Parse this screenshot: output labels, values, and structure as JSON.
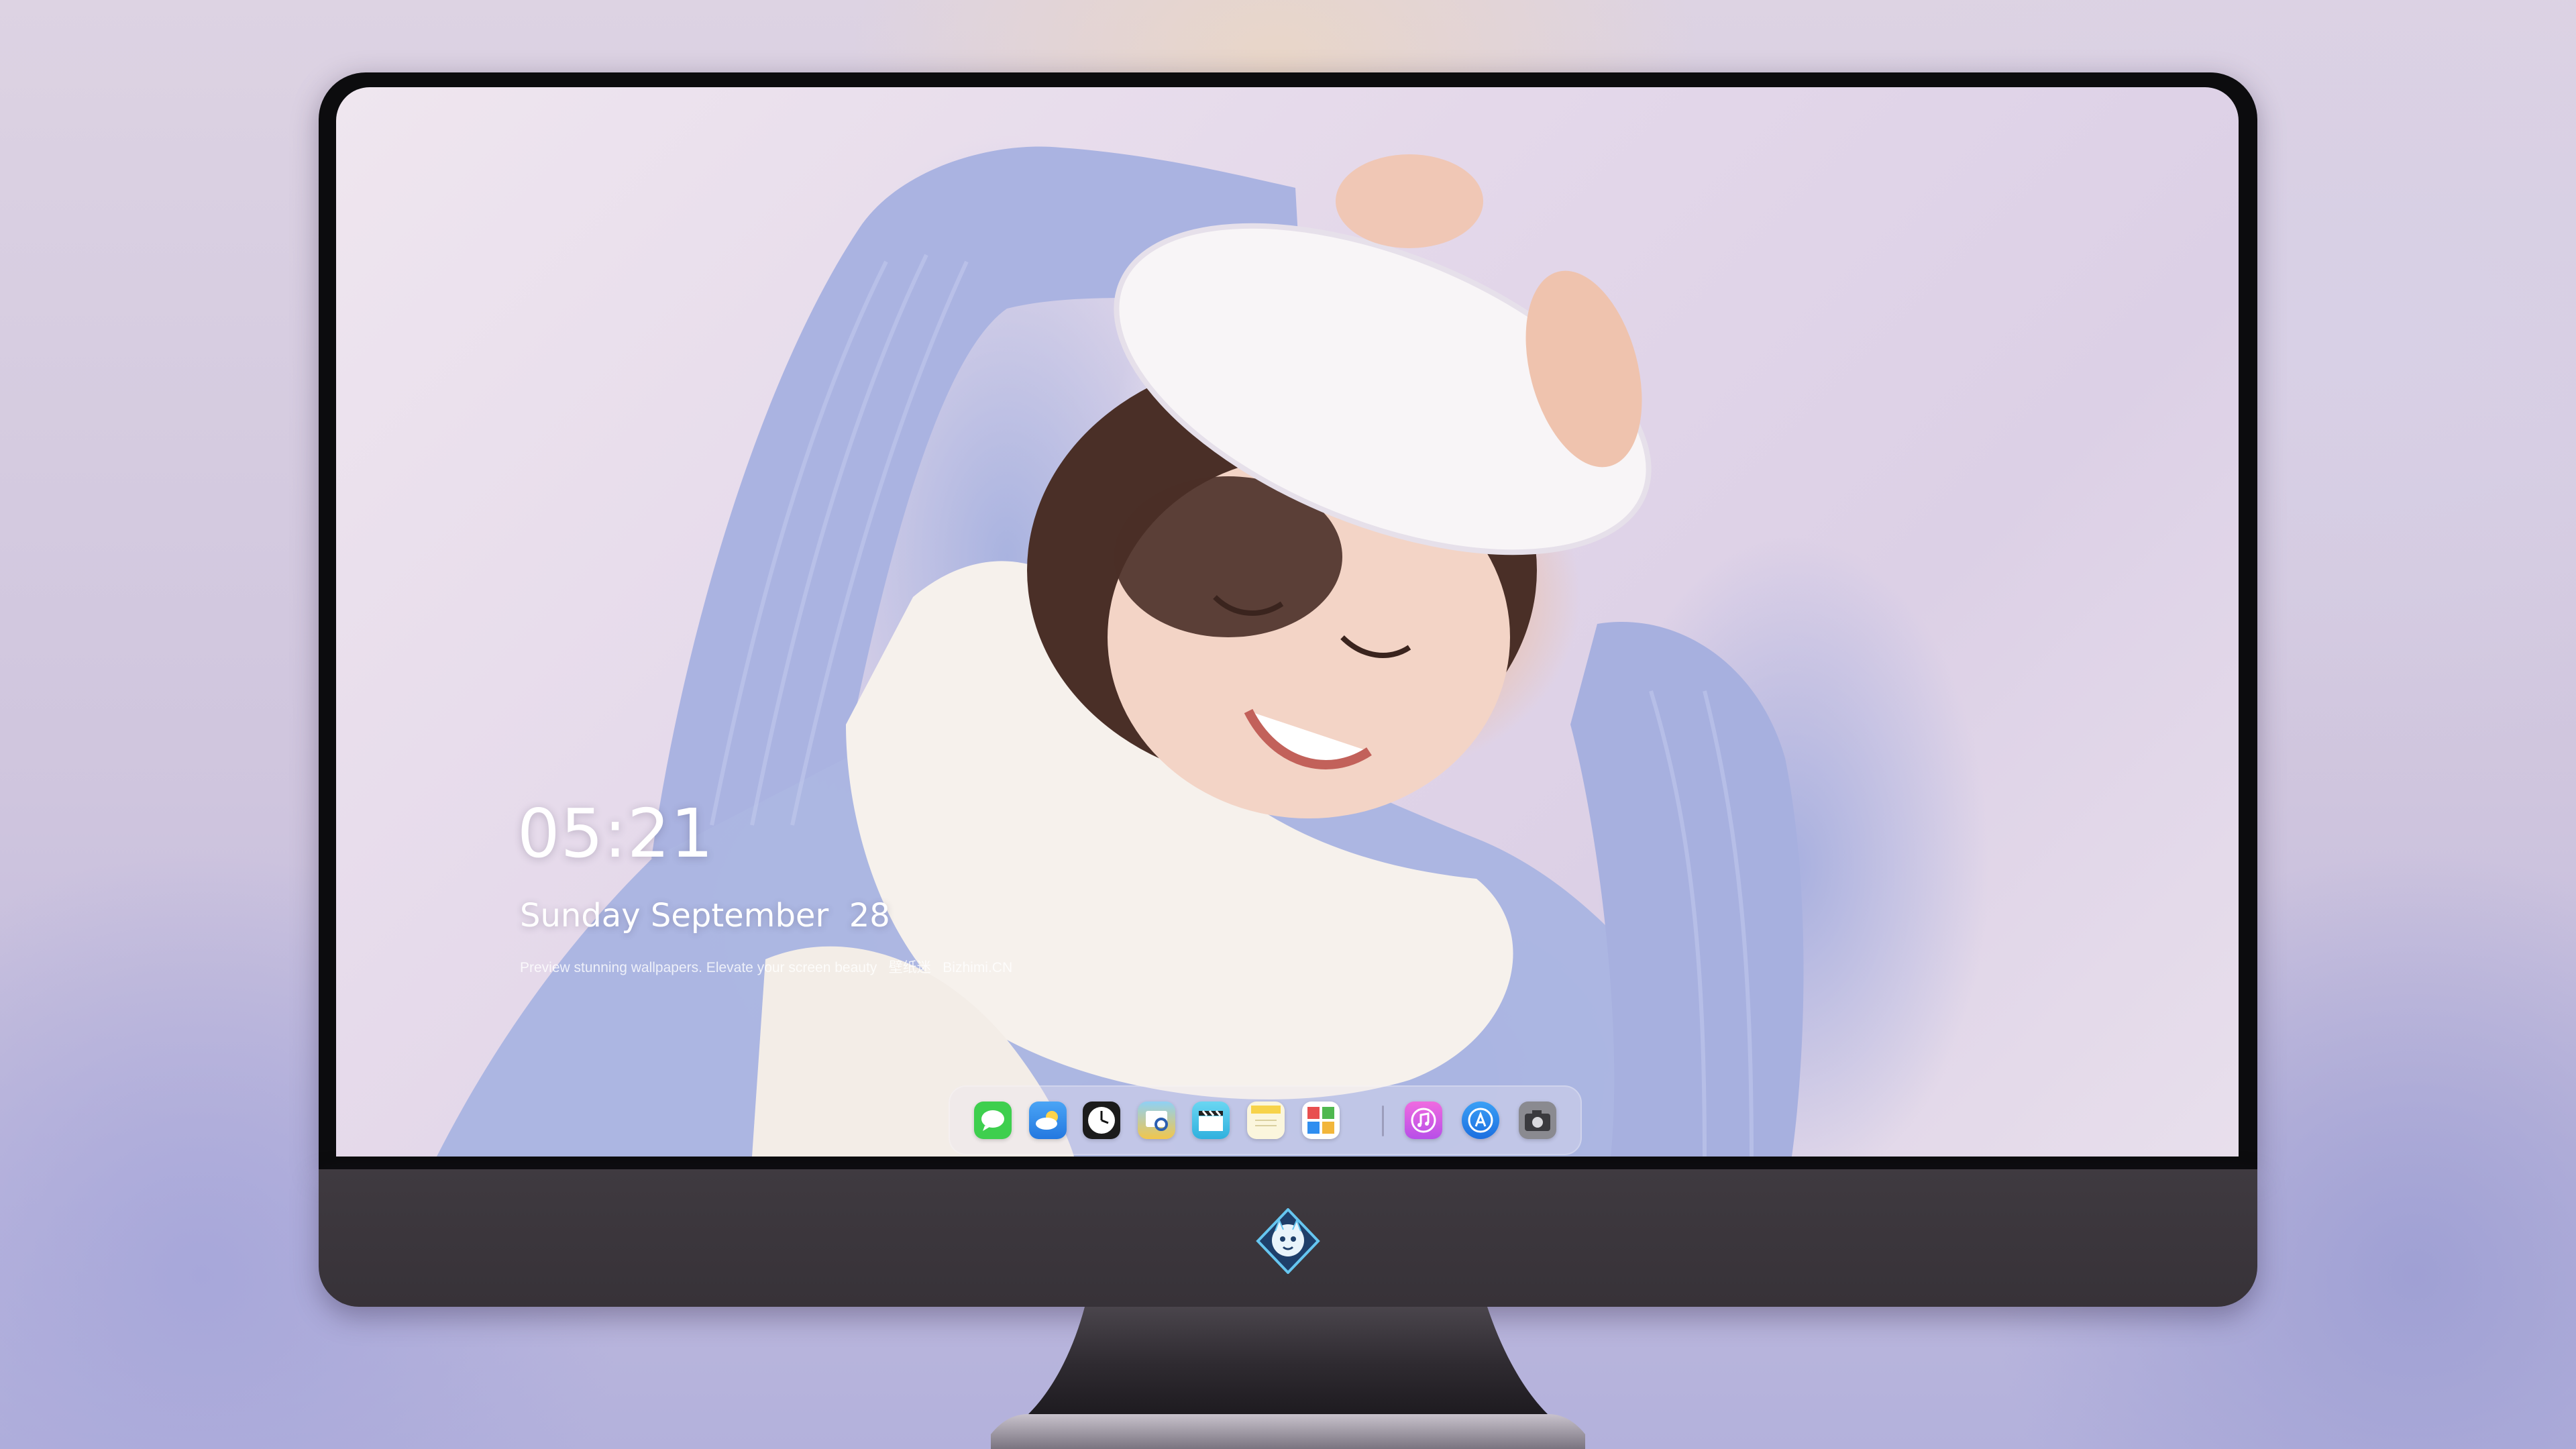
{
  "lock_screen": {
    "time": "05:21",
    "date": "Sunday September  28",
    "caption": "Preview stunning wallpapers. Elevate your screen beauty   壁纸迷   Bizhimi.CN"
  },
  "dock": {
    "apps": [
      {
        "name": "Messages",
        "icon": "message-bubble-icon",
        "color": "#3ecf4e"
      },
      {
        "name": "Weather",
        "icon": "weather-cloud-icon",
        "color": "#2f8ef0"
      },
      {
        "name": "Clock",
        "icon": "clock-icon",
        "color": "#1b1b1b"
      },
      {
        "name": "Preview",
        "icon": "preview-icon",
        "color": "#f2c64b"
      },
      {
        "name": "Final Cut",
        "icon": "clapperboard-icon",
        "color": "#4fc6e8"
      },
      {
        "name": "Notes",
        "icon": "notes-icon",
        "color": "#f7e26b"
      },
      {
        "name": "Photo Booth",
        "icon": "photo-booth-icon",
        "color": "#e84f4f"
      },
      {
        "name": "iTunes",
        "icon": "music-note-icon",
        "color": "#d64fe0"
      },
      {
        "name": "App Store",
        "icon": "app-store-icon",
        "color": "#2f8ef0"
      },
      {
        "name": "Camera",
        "icon": "camera-icon",
        "color": "#8a8a90"
      }
    ]
  },
  "monitor": {
    "logo": "mascot-logo-icon"
  }
}
